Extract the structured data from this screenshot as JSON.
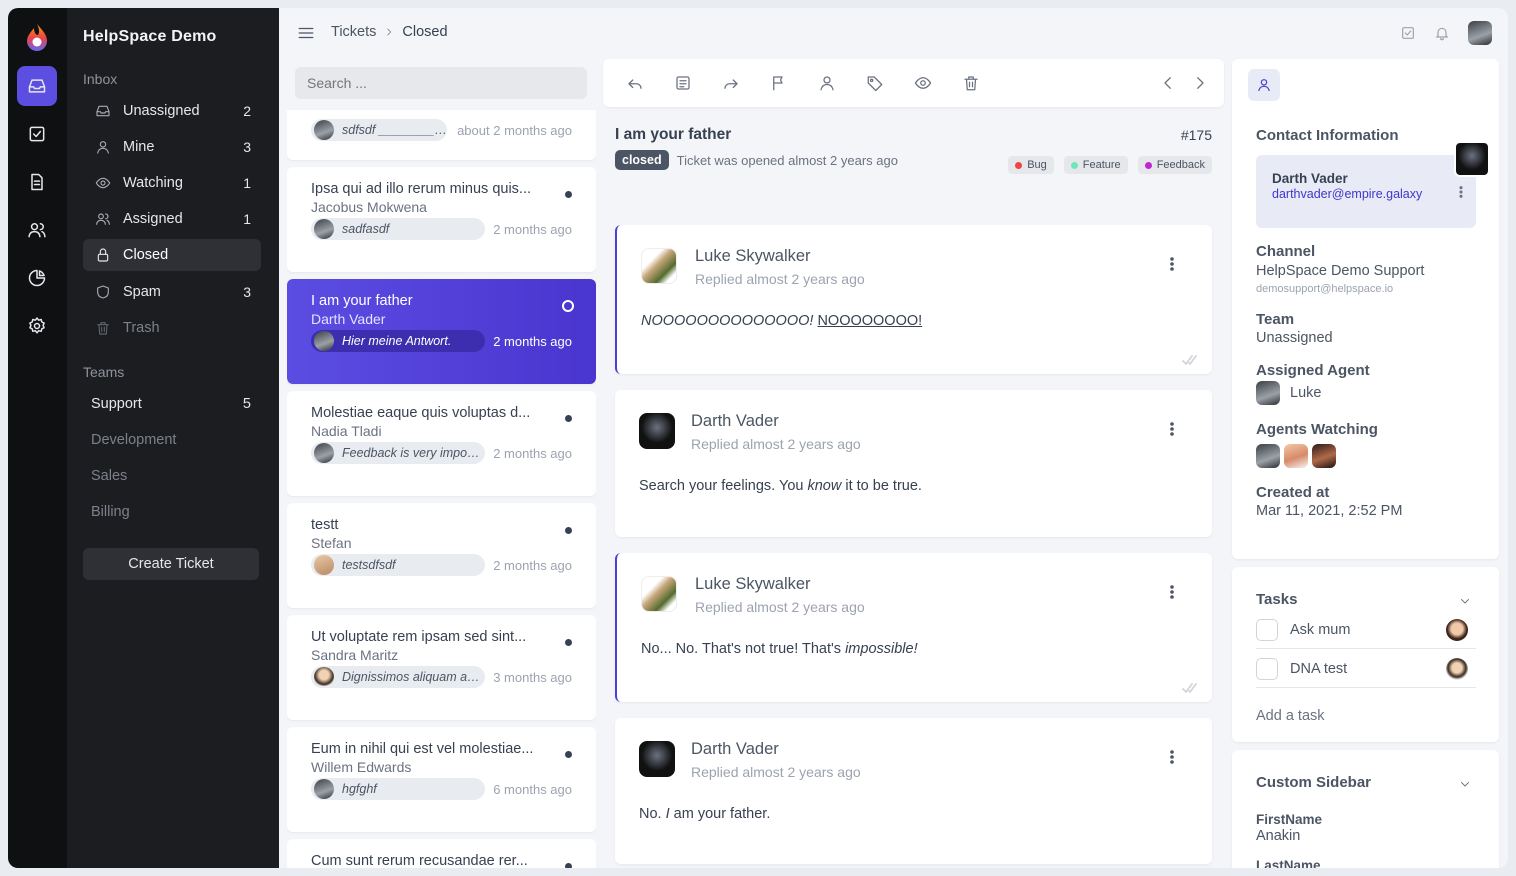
{
  "app": {
    "brand": "HelpSpace Demo"
  },
  "nav": {
    "inbox_label": "Inbox",
    "items": [
      {
        "label": "Unassigned",
        "count": "2",
        "icon": "inbox-icon"
      },
      {
        "label": "Mine",
        "count": "3",
        "icon": "user-icon"
      },
      {
        "label": "Watching",
        "count": "1",
        "icon": "eye-icon"
      },
      {
        "label": "Assigned",
        "count": "1",
        "icon": "users-icon"
      },
      {
        "label": "Closed",
        "count": "",
        "icon": "lock-icon"
      },
      {
        "label": "Spam",
        "count": "3",
        "icon": "shield-icon"
      },
      {
        "label": "Trash",
        "count": "",
        "icon": "trash-icon"
      }
    ],
    "teams_label": "Teams",
    "teams": [
      {
        "label": "Support",
        "count": "5"
      },
      {
        "label": "Development",
        "count": ""
      },
      {
        "label": "Sales",
        "count": ""
      },
      {
        "label": "Billing",
        "count": ""
      }
    ],
    "create_label": "Create Ticket"
  },
  "breadcrumb": {
    "root": "Tickets",
    "current": "Closed"
  },
  "list": {
    "search_placeholder": "Search ...",
    "tickets": [
      {
        "title": "",
        "from": "",
        "snippet": "sdfsdf ________ J...",
        "when": "about 2 months ago"
      },
      {
        "title": "Ipsa qui ad illo rerum minus quis...",
        "from": "Jacobus Mokwena",
        "snippet": "sadfasdf",
        "when": "2 months ago"
      },
      {
        "title": "I am your father",
        "from": "Darth Vader",
        "snippet": "Hier meine Antwort.",
        "when": "2 months ago"
      },
      {
        "title": "Molestiae eaque quis voluptas d...",
        "from": "Nadia Tladi",
        "snippet": "Feedback is very import...",
        "when": "2 months ago"
      },
      {
        "title": "testt",
        "from": "Stefan",
        "snippet": "testsdfsdf",
        "when": "2 months ago"
      },
      {
        "title": "Ut voluptate rem ipsam sed sint...",
        "from": "Sandra Maritz",
        "snippet": "Dignissimos aliquam au...",
        "when": "3 months ago"
      },
      {
        "title": "Eum in nihil qui est vel molestiae...",
        "from": "Willem Edwards",
        "snippet": "hgfghf",
        "when": "6 months ago"
      },
      {
        "title": "Cum sunt rerum recusandae rer...",
        "from": "",
        "snippet": "",
        "when": ""
      }
    ]
  },
  "ticket": {
    "title": "I am your father",
    "number": "#175",
    "status": "closed",
    "opened": "Ticket was opened almost 2 years ago",
    "tags": [
      {
        "label": "Bug",
        "color": "#ef4444"
      },
      {
        "label": "Feature",
        "color": "#6ee7b7"
      },
      {
        "label": "Feedback",
        "color": "#c026d3"
      }
    ],
    "messages": [
      {
        "author": "Luke Skywalker",
        "ago": "Replied almost 2 years ago",
        "body_a": "NOOOOOOOOOOOOOO!",
        "body_b": "NOOOOOOOO!"
      },
      {
        "author": "Darth Vader",
        "ago": "Replied almost 2 years ago",
        "body_a": "Search your feelings. You ",
        "body_em": "know",
        "body_b": " it to be true."
      },
      {
        "author": "Luke Skywalker",
        "ago": "Replied almost 2 years ago",
        "body_a": "No... No. That's not true! That's ",
        "body_em": "impossible!"
      },
      {
        "author": "Darth Vader",
        "ago": "Replied almost 2 years ago",
        "body_a": "No. ",
        "body_em": "I",
        "body_b": " am your father."
      }
    ]
  },
  "contact": {
    "heading": "Contact Information",
    "name": "Darth Vader",
    "email": "darthvader@empire.galaxy",
    "channel_label": "Channel",
    "channel": "HelpSpace Demo Support",
    "channel_email": "demosupport@helpspace.io",
    "team_label": "Team",
    "team": "Unassigned",
    "agent_label": "Assigned Agent",
    "agent": "Luke",
    "watching_label": "Agents Watching",
    "created_label": "Created at",
    "created": "Mar 11, 2021, 2:52 PM"
  },
  "tasks": {
    "heading": "Tasks",
    "items": [
      {
        "label": "Ask mum"
      },
      {
        "label": "DNA test"
      }
    ],
    "add_label": "Add a task"
  },
  "custom": {
    "heading": "Custom Sidebar",
    "first_label": "FirstName",
    "first": "Anakin",
    "last_label": "LastName"
  },
  "colors": {
    "accent": "#5b4ee0",
    "rail": "#0f1012",
    "nav": "#1c1d21"
  }
}
